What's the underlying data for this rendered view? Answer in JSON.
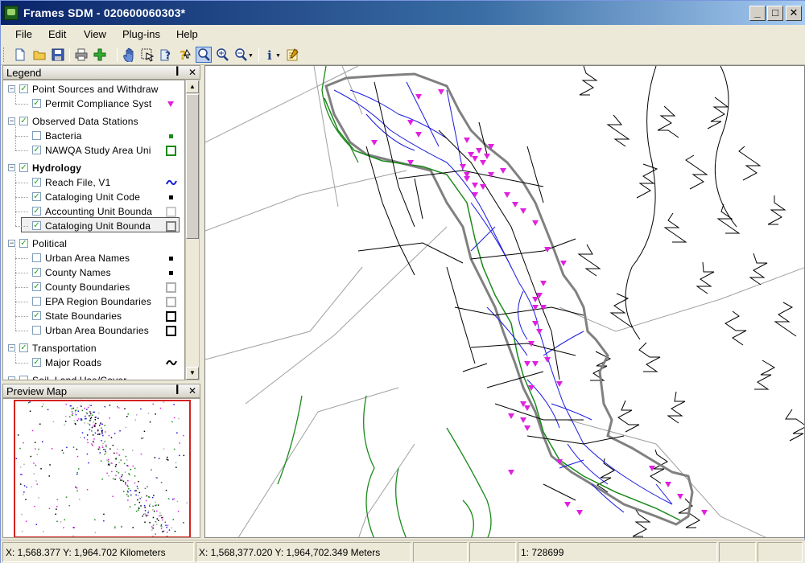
{
  "window": {
    "title": "Frames SDM  - 020600060303*"
  },
  "menus": [
    "File",
    "Edit",
    "View",
    "Plug-ins",
    "Help"
  ],
  "toolbar": {
    "icons": [
      "new-icon",
      "open-icon",
      "save-icon",
      "print-icon",
      "add-layer-icon",
      "pan-icon",
      "select-icon",
      "help-query-icon",
      "identify-help-icon",
      "zoom-area-icon",
      "zoom-in-icon",
      "zoom-out-icon",
      "info-icon",
      "properties-icon"
    ]
  },
  "legend": {
    "title": "Legend",
    "groups": [
      {
        "label": "Point  Sources  and  Withdraw",
        "checked": true,
        "expanded": true,
        "bold": false,
        "items": [
          {
            "label": "Permit  Compliance  Syst",
            "checked": true,
            "symbol": "triangle",
            "color": "#e020e0"
          }
        ]
      },
      {
        "label": "Observed Data Stations",
        "checked": true,
        "expanded": true,
        "bold": false,
        "items": [
          {
            "label": "Bacteria",
            "checked": false,
            "symbol": "dot",
            "color": "#1a8a1a"
          },
          {
            "label": "NAWQA  Study  Area Uni",
            "checked": true,
            "symbol": "square",
            "color": "#1a8a1a"
          }
        ]
      },
      {
        "label": "Hydrology",
        "checked": true,
        "expanded": true,
        "bold": true,
        "items": [
          {
            "label": "Reach File, V1",
            "checked": true,
            "symbol": "wave",
            "color": "#1a1ae0"
          },
          {
            "label": "Cataloging Unit Code",
            "checked": true,
            "symbol": "dot",
            "color": "#000000"
          },
          {
            "label": "Accounting  Unit Bounda",
            "checked": true,
            "symbol": "square",
            "color": "#c8c8c8"
          },
          {
            "label": "Cataloging  Unit Bounda",
            "checked": true,
            "symbol": "square",
            "color": "#808080"
          }
        ]
      },
      {
        "label": "Political",
        "checked": true,
        "expanded": true,
        "bold": false,
        "items": [
          {
            "label": "Urban Area Names",
            "checked": false,
            "symbol": "dot",
            "color": "#000000"
          },
          {
            "label": "County Names",
            "checked": true,
            "symbol": "dot",
            "color": "#000000"
          },
          {
            "label": "County Boundaries",
            "checked": true,
            "symbol": "square",
            "color": "#b0b0b0"
          },
          {
            "label": "EPA Region Boundaries",
            "checked": false,
            "symbol": "square",
            "color": "#b0b0b0"
          },
          {
            "label": "State Boundaries",
            "checked": true,
            "symbol": "square",
            "color": "#000000"
          },
          {
            "label": "Urban Area Boundaries",
            "checked": false,
            "symbol": "square",
            "color": "#000000"
          }
        ]
      },
      {
        "label": "Transportation",
        "checked": true,
        "expanded": true,
        "bold": false,
        "items": [
          {
            "label": "Major Roads",
            "checked": true,
            "symbol": "wave",
            "color": "#000000"
          }
        ]
      },
      {
        "label": "Soil, Land Use/Cover",
        "checked": false,
        "expanded": true,
        "bold": false,
        "items": []
      }
    ]
  },
  "preview": {
    "title": "Preview Map"
  },
  "status": {
    "coords_km": "X: 1,568.377 Y: 1,964.702 Kilometers",
    "coords_m": "X: 1,568,377.020 Y: 1,964,702.349 Meters",
    "scale": "1: 728699"
  },
  "colors": {
    "river": "#1a1ae0",
    "road": "#000000",
    "watershed_outline": "#808080",
    "county_boundary": "#a0a0a0",
    "nawqa_boundary": "#1a8a1a",
    "permit_marker": "#e020e0"
  }
}
